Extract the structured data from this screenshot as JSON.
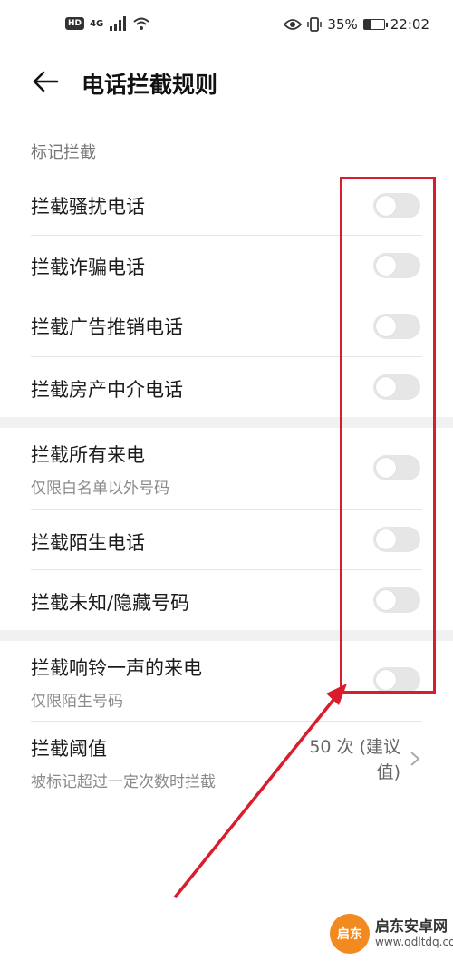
{
  "status_bar": {
    "left_badge": "HD",
    "network": "4G",
    "battery_percent": "35%",
    "time": "22:02"
  },
  "header": {
    "title": "电话拦截规则"
  },
  "sections": {
    "mark_block_header": "标记拦截"
  },
  "rows": {
    "harassment": "拦截骚扰电话",
    "fraud": "拦截诈骗电话",
    "ads": "拦截广告推销电话",
    "realestate": "拦截房产中介电话",
    "all_calls": "拦截所有来电",
    "all_calls_sub": "仅限白名单以外号码",
    "stranger": "拦截陌生电话",
    "unknown_hidden": "拦截未知/隐藏号码",
    "one_ring": "拦截响铃一声的来电",
    "one_ring_sub": "仅限陌生号码",
    "threshold": "拦截阈值",
    "threshold_sub": "被标记超过一定次数时拦截",
    "threshold_value_line1": "50 次 (建议",
    "threshold_value_line2": "值)"
  },
  "toggles": {
    "harassment": false,
    "fraud": false,
    "ads": false,
    "realestate": false,
    "all_calls": false,
    "stranger": false,
    "unknown_hidden": false,
    "one_ring": false
  },
  "watermark": {
    "logo_text": "启东",
    "title": "启东安卓网",
    "url": "www.qdltdq.com"
  },
  "colors": {
    "annotation": "#d81e2c",
    "toggle_off": "#e6e6e6"
  }
}
